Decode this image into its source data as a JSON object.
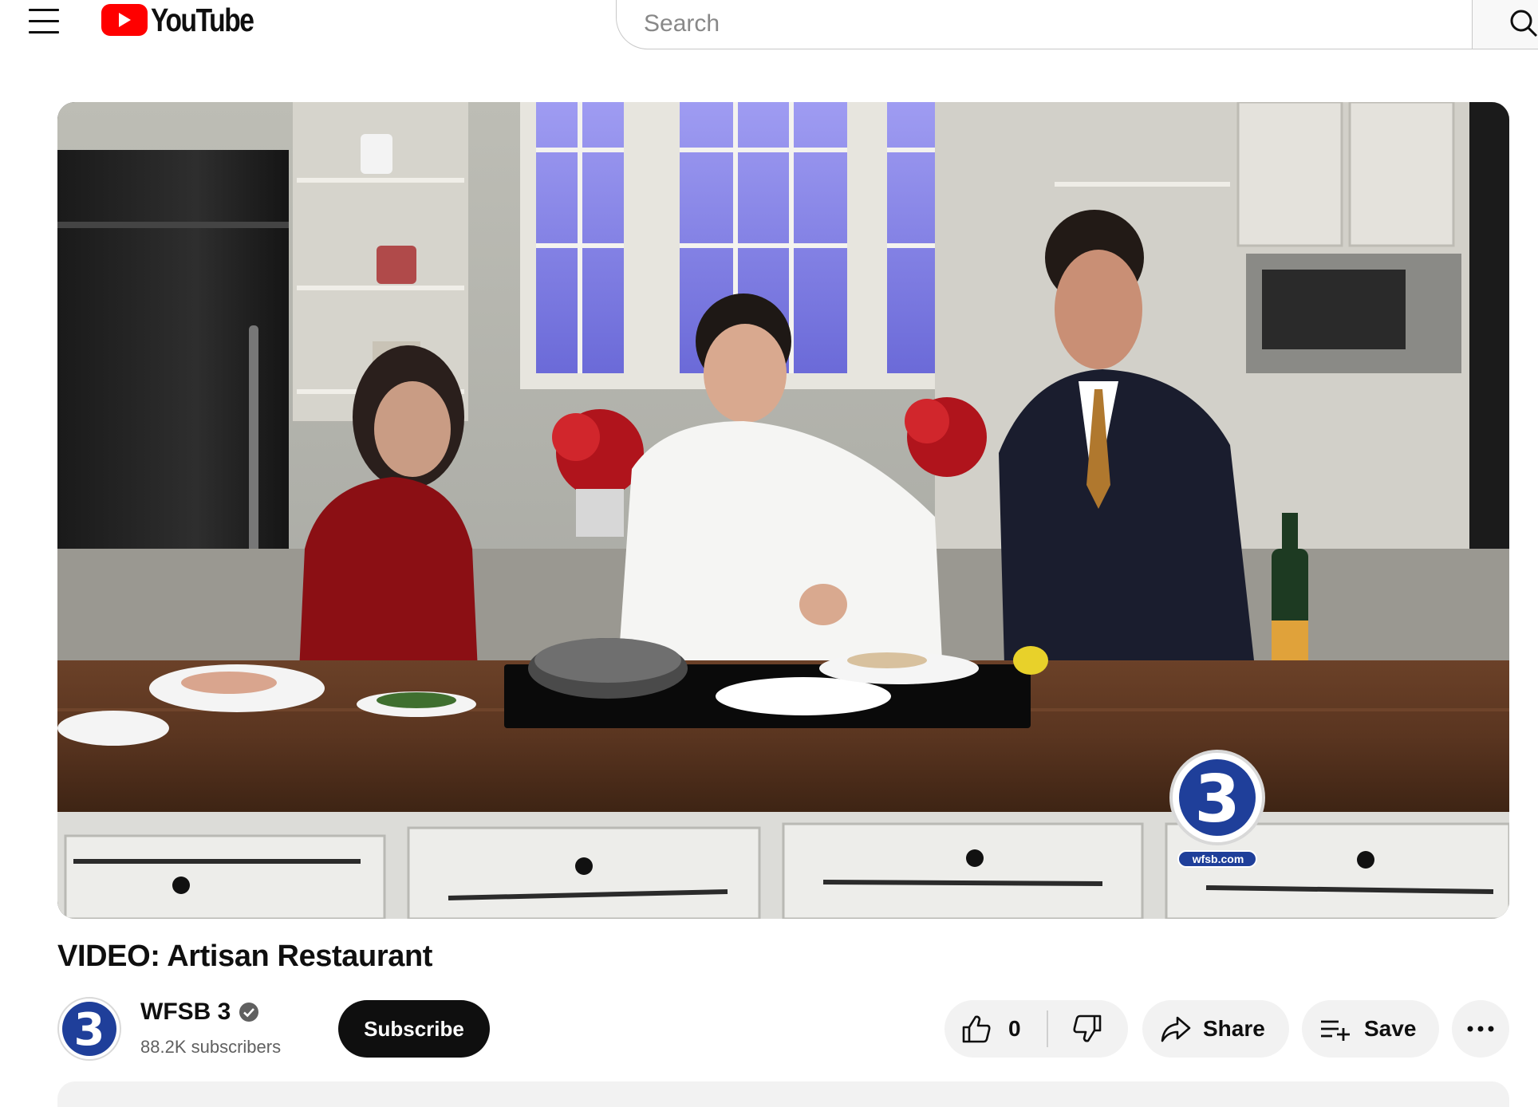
{
  "masthead": {
    "logo_text": "YouTube",
    "search_placeholder": "Search",
    "icons": {
      "menu": "hamburger-menu-icon",
      "search": "search-icon"
    }
  },
  "player": {
    "overlay_logo_text": "wfsb.com",
    "bug_icon": "channel-3-logo"
  },
  "video": {
    "title": "VIDEO: Artisan Restaurant"
  },
  "channel": {
    "name": "WFSB 3",
    "subscribers": "88.2K subscribers",
    "subscribe_label": "Subscribe",
    "verified_icon": "verified-check-icon"
  },
  "actions": {
    "like_count": "0",
    "share_label": "Share",
    "save_label": "Save",
    "icons": {
      "like": "thumbs-up-icon",
      "dislike": "thumbs-down-icon",
      "share": "share-arrow-icon",
      "save": "add-to-playlist-icon",
      "more": "more-horizontal-icon"
    }
  },
  "colors": {
    "brand_red": "#ff0000",
    "text_primary": "#0f0f0f",
    "text_secondary": "#606060",
    "pill_bg": "#f2f2f2",
    "wfsb_blue": "#1f3f9a"
  }
}
